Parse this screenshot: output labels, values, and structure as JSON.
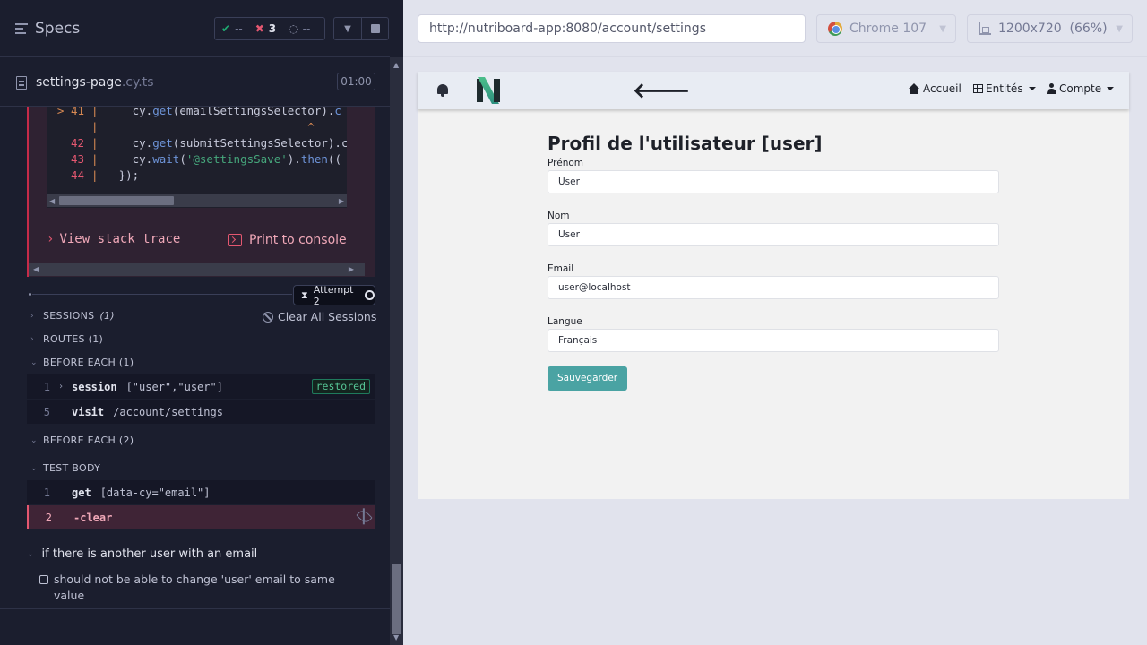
{
  "reporter": {
    "specs_label": "Specs",
    "stats": {
      "passed": "--",
      "failed": "3",
      "pending": "--"
    },
    "spec": {
      "name": "settings-page",
      "ext": ".cy.ts",
      "time": "01:00"
    },
    "code_lines": [
      {
        "num": "> 41",
        "code": "cy.get(emailSettingsSelector).c"
      },
      {
        "num": "",
        "code": "                              ^"
      },
      {
        "num": "42",
        "code": "cy.get(submitSettingsSelector).c"
      },
      {
        "num": "43",
        "code": "cy.wait('@settingsSave').then(("
      },
      {
        "num": "44",
        "code": "});"
      }
    ],
    "view_stack_trace": "View stack trace",
    "print_to_console": "Print to console",
    "attempt": "Attempt 2",
    "sessions": {
      "label": "SESSIONS",
      "count": "(1)"
    },
    "clear_sessions": "Clear All Sessions",
    "routes": "ROUTES (1)",
    "before_each_1": "BEFORE EACH (1)",
    "before_each_2": "BEFORE EACH (2)",
    "test_body": "TEST BODY",
    "hook_commands": [
      {
        "num": "1",
        "name": "session",
        "msg": "[\"user\",\"user\"]",
        "badge": "restored"
      },
      {
        "num": "5",
        "name": "visit",
        "msg": "/account/settings"
      }
    ],
    "body_commands": [
      {
        "num": "1",
        "name": "get",
        "msg": "[data-cy=\"email\"]"
      },
      {
        "num": "2",
        "name": "-clear",
        "msg": ""
      }
    ],
    "suite_title": "if there is another user with an email",
    "test_title": "should not be able to change 'user' email to same value"
  },
  "browser": {
    "url": "http://nutriboard-app:8080/account/settings",
    "name": "Chrome 107",
    "viewport": "1200x720  (66%)"
  },
  "app": {
    "nav": {
      "home": "Accueil",
      "entities": "Entités",
      "account": "Compte"
    },
    "page_title": "Profil de l'utilisateur [user]",
    "fields": {
      "first_name": {
        "label": "Prénom",
        "value": "User"
      },
      "last_name": {
        "label": "Nom",
        "value": "User"
      },
      "email": {
        "label": "Email",
        "value": "user@localhost"
      },
      "language": {
        "label": "Langue",
        "value": "Français"
      }
    },
    "save_button": "Sauvegarder"
  }
}
